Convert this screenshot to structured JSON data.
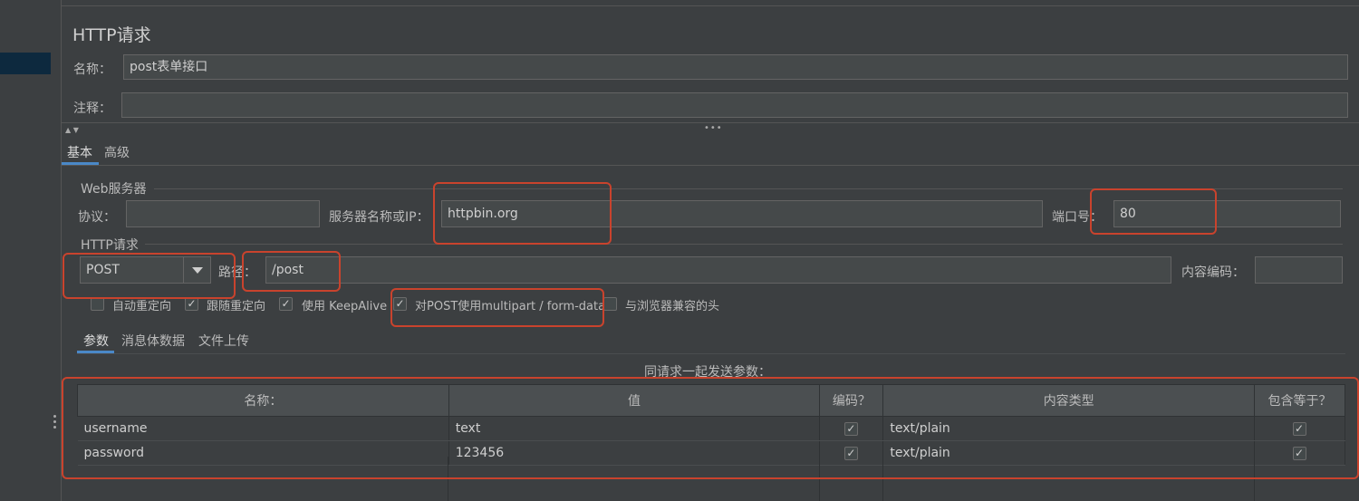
{
  "panel": {
    "title": "HTTP请求"
  },
  "name_field": {
    "label": "名称：",
    "value": "post表单接口"
  },
  "comment_field": {
    "label": "注释：",
    "value": ""
  },
  "tabs": [
    {
      "label": "基本"
    },
    {
      "label": "高级"
    }
  ],
  "web_server": {
    "section_title": "Web服务器",
    "protocol_label": "协议：",
    "protocol_value": "",
    "server_label": "服务器名称或IP：",
    "server_value": "httpbin.org",
    "port_label": "端口号：",
    "port_value": "80"
  },
  "http_request": {
    "section_title": "HTTP请求",
    "method_value": "POST",
    "path_label": "路径：",
    "path_value": "/post",
    "encoding_label": "内容编码：",
    "encoding_value": ""
  },
  "options": [
    {
      "label": "自动重定向",
      "checked": false
    },
    {
      "label": "跟随重定向",
      "checked": true
    },
    {
      "label": "使用 KeepAlive",
      "checked": true
    },
    {
      "label": "对POST使用multipart / form-data",
      "checked": true
    },
    {
      "label": "与浏览器兼容的头",
      "checked": false
    }
  ],
  "subtabs": [
    {
      "label": "参数"
    },
    {
      "label": "消息体数据"
    },
    {
      "label": "文件上传"
    }
  ],
  "params": {
    "caption": "同请求一起发送参数：",
    "columns": [
      "名称：",
      "值",
      "编码？",
      "内容类型",
      "包含等于？"
    ],
    "rows": [
      {
        "name": "username",
        "value": "text",
        "encode": true,
        "content_type": "text/plain",
        "include_equals": true
      },
      {
        "name": "password",
        "value": "123456",
        "encode": true,
        "content_type": "text/plain",
        "include_equals": true
      }
    ]
  },
  "check_mark": "✓",
  "colors": {
    "highlight": "#c9432d",
    "accent": "#4a88c7",
    "background": "#3c3f41"
  }
}
